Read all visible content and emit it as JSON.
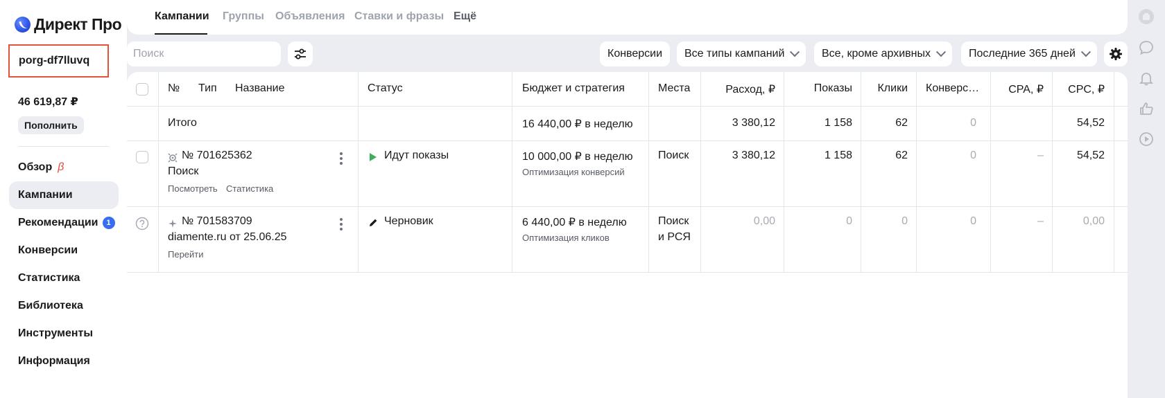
{
  "app": {
    "logo_text": "Директ Про"
  },
  "account": {
    "login": "porg-df7lluvq",
    "balance": "46 619,87 ₽",
    "topup_label": "Пополнить"
  },
  "nav": {
    "overview": "Обзор",
    "overview_badge": "β",
    "campaigns": "Кампании",
    "recommendations": "Рекомендации",
    "recommendations_count": "1",
    "conversions": "Конверсии",
    "statistics": "Статистика",
    "library": "Библиотека",
    "tools": "Инструменты",
    "info": "Информация"
  },
  "tabs": {
    "campaigns": "Кампании",
    "groups": "Группы",
    "ads": "Объявления",
    "bids": "Ставки и фразы",
    "more": "Ещё"
  },
  "filters": {
    "search_placeholder": "Поиск",
    "conversions": "Конверсии",
    "campaign_types": "Все типы кампаний",
    "archive": "Все, кроме архивных",
    "period": "Последние 365 дней"
  },
  "table": {
    "headers": {
      "num": "№",
      "type": "Тип",
      "name": "Название",
      "status": "Статус",
      "budget": "Бюджет и стратегия",
      "places": "Места",
      "spend": "Расход, ₽",
      "impressions": "Показы",
      "clicks": "Клики",
      "conversions": "Конверс…",
      "cpa": "CPA, ₽",
      "cpc": "CPC, ₽"
    },
    "total": {
      "label": "Итого",
      "budget": "16 440,00 ₽ в неделю",
      "spend": "3 380,12",
      "impressions": "1 158",
      "clicks": "62",
      "conversions": "0",
      "cpc": "54,52"
    },
    "rows": [
      {
        "id": "№ 701625362",
        "name": "Поиск",
        "link1": "Посмотреть",
        "link2": "Статистика",
        "status": "Идут показы",
        "budget": "10 000,00 ₽ в неделю",
        "strategy": "Оптимизация конверсий",
        "places": "Поиск",
        "spend": "3 380,12",
        "impressions": "1 158",
        "clicks": "62",
        "conversions": "0",
        "cpa": "–",
        "cpc": "54,52"
      },
      {
        "id": "№ 701583709",
        "name": "diamente.ru от 25.06.25",
        "link1": "Перейти",
        "status": "Черновик",
        "budget": "6 440,00 ₽ в неделю",
        "strategy": "Оптимизация кликов",
        "places_line1": "Поиск",
        "places_line2": "и РСЯ",
        "spend": "0,00",
        "impressions": "0",
        "clicks": "0",
        "conversions": "0",
        "cpa": "–",
        "cpc": "0,00"
      }
    ]
  },
  "colors": {
    "accent": "#3a6cf0",
    "highlight_border": "#e2523d",
    "status_active": "#3fae5a"
  }
}
